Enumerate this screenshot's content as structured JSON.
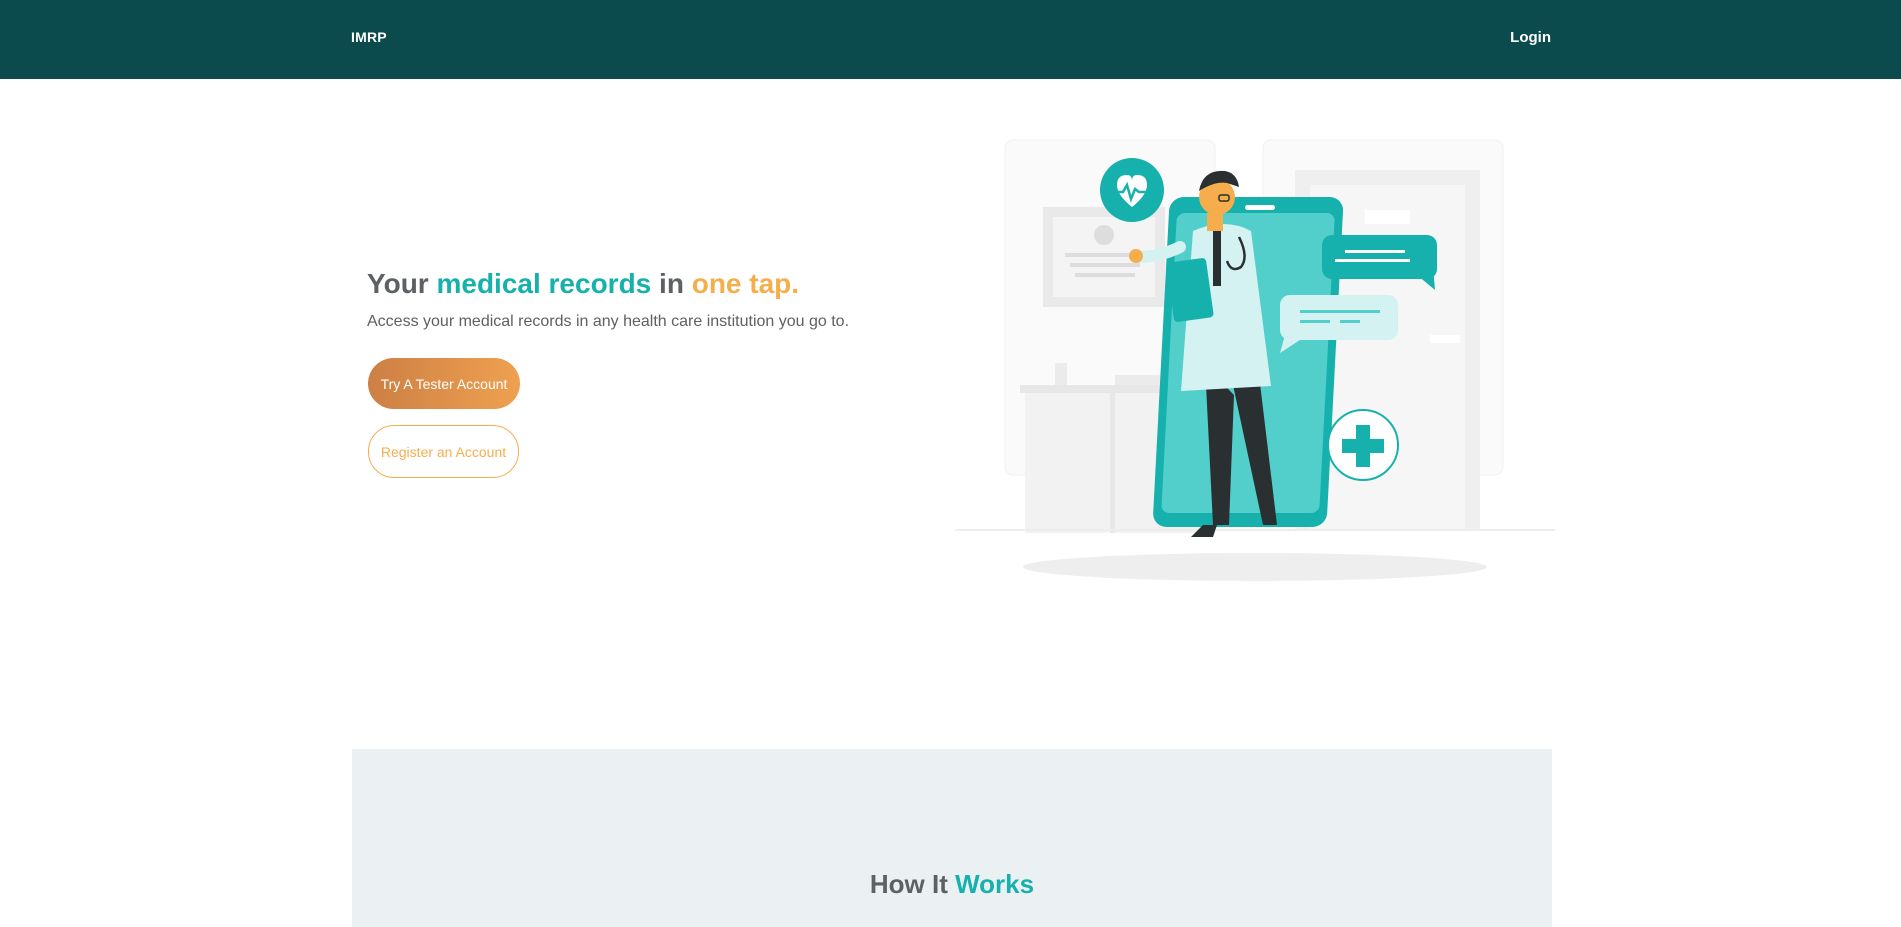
{
  "navbar": {
    "brand": "IMRP",
    "login_label": "Login",
    "background": "#0b4b4d"
  },
  "hero": {
    "title_part1": "Your",
    "title_part2": "medical records",
    "title_part3": "in",
    "title_part4": "one tap.",
    "subtitle": "Access your medical records in any health care institution you go to.",
    "primary_button": "Try A Tester Account",
    "secondary_button": "Register an Account",
    "illustration": "doctor-with-phone-illustration"
  },
  "how_it_works": {
    "title_part1": "How It",
    "title_part2": "Works"
  },
  "colors": {
    "teal": "#16b1ad",
    "orange": "#f6ae4d",
    "dark_teal": "#0b4b4d",
    "section_bg": "#ebf0f3"
  }
}
